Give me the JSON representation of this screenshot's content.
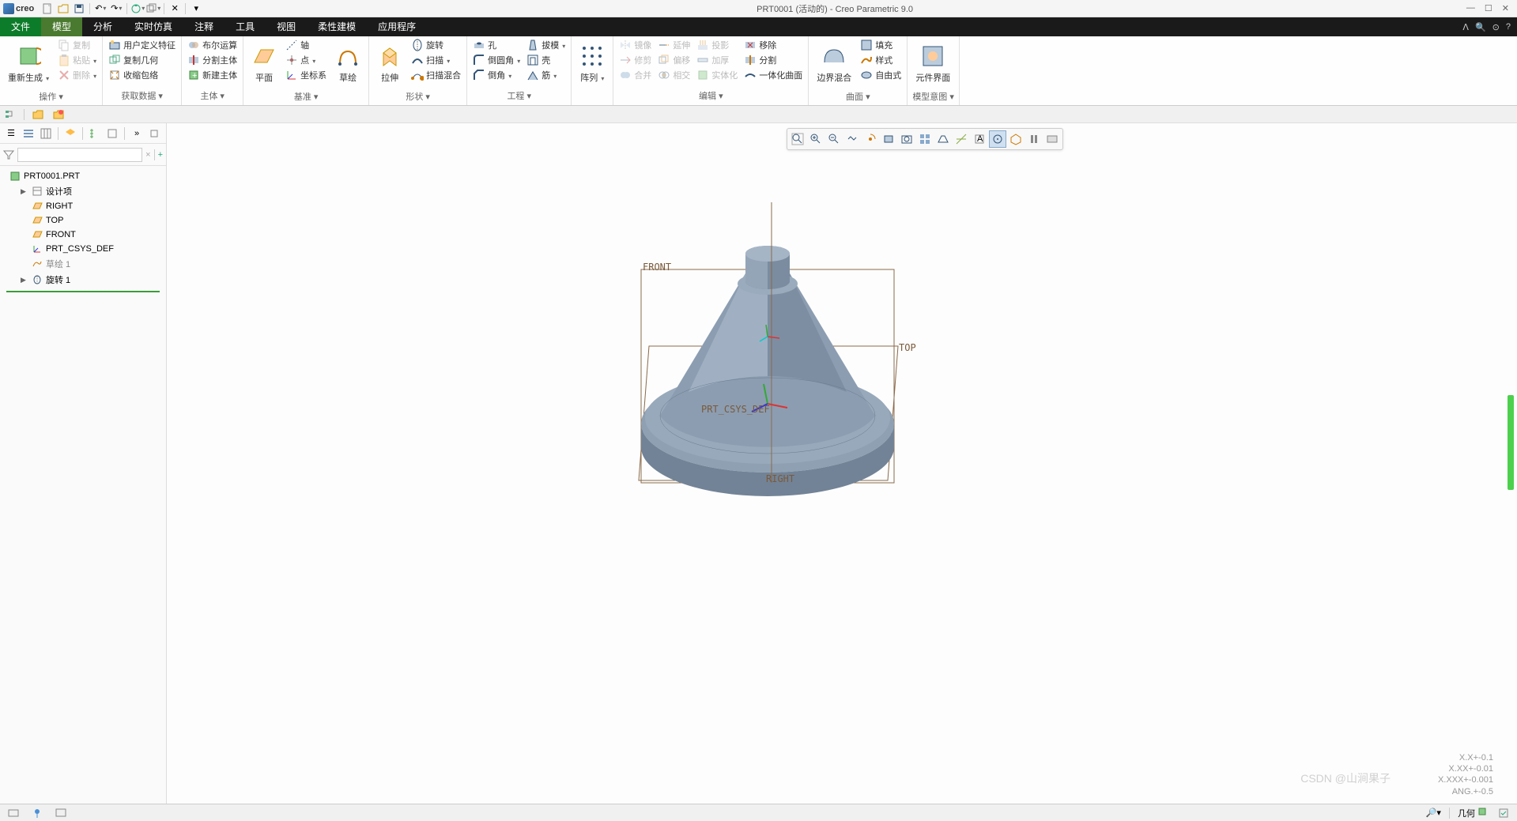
{
  "app": {
    "logo": "creo",
    "title": "PRT0001 (活动的) - Creo Parametric 9.0"
  },
  "menu": {
    "tabs": [
      "文件",
      "模型",
      "分析",
      "实时仿真",
      "注释",
      "工具",
      "视图",
      "柔性建模",
      "应用程序"
    ],
    "activeIndex": 1
  },
  "ribbon": {
    "groups": [
      {
        "label": "操作 ▾",
        "cols": [
          {
            "big": true,
            "items": [
              {
                "icon": "regen",
                "label": "重新生成",
                "arrow": true
              }
            ]
          },
          {
            "items": [
              {
                "icon": "copy",
                "label": "复制",
                "disabled": true
              },
              {
                "icon": "paste",
                "label": "粘贴",
                "arrow": true,
                "disabled": true
              },
              {
                "icon": "delete",
                "label": "删除",
                "arrow": true,
                "disabled": true
              }
            ]
          }
        ]
      },
      {
        "label": "获取数据 ▾",
        "cols": [
          {
            "items": [
              {
                "icon": "udf",
                "label": "用户定义特征"
              },
              {
                "icon": "copygeom",
                "label": "复制几何"
              },
              {
                "icon": "shrink",
                "label": "收缩包络"
              }
            ]
          }
        ]
      },
      {
        "label": "主体 ▾",
        "cols": [
          {
            "items": [
              {
                "icon": "bool",
                "label": "布尔运算"
              },
              {
                "icon": "split",
                "label": "分割主体"
              },
              {
                "icon": "newbody",
                "label": "新建主体"
              }
            ]
          }
        ]
      },
      {
        "label": "基准 ▾",
        "cols": [
          {
            "big": true,
            "items": [
              {
                "icon": "plane",
                "label": "平面"
              }
            ]
          },
          {
            "items": [
              {
                "icon": "axis",
                "label": "轴"
              },
              {
                "icon": "point",
                "label": "点",
                "arrow": true
              },
              {
                "icon": "csys",
                "label": "坐标系"
              }
            ]
          },
          {
            "big": true,
            "items": [
              {
                "icon": "sketch",
                "label": "草绘"
              }
            ]
          }
        ]
      },
      {
        "label": "形状 ▾",
        "cols": [
          {
            "big": true,
            "items": [
              {
                "icon": "extrude",
                "label": "拉伸"
              }
            ]
          },
          {
            "items": [
              {
                "icon": "revolve",
                "label": "旋转"
              },
              {
                "icon": "sweep",
                "label": "扫描",
                "arrow": true
              },
              {
                "icon": "sweepblend",
                "label": "扫描混合"
              }
            ]
          }
        ]
      },
      {
        "label": "工程 ▾",
        "cols": [
          {
            "items": [
              {
                "icon": "hole",
                "label": "孔"
              },
              {
                "icon": "round",
                "label": "倒圆角",
                "arrow": true
              },
              {
                "icon": "chamfer",
                "label": "倒角",
                "arrow": true
              }
            ]
          },
          {
            "items": [
              {
                "icon": "draft",
                "label": "拔模",
                "arrow": true
              },
              {
                "icon": "shell",
                "label": "壳"
              },
              {
                "icon": "rib",
                "label": "筋",
                "arrow": true
              }
            ]
          }
        ]
      },
      {
        "label": "",
        "cols": [
          {
            "big": true,
            "items": [
              {
                "icon": "pattern",
                "label": "阵列",
                "arrow": true
              }
            ]
          }
        ]
      },
      {
        "label": "编辑 ▾",
        "cols": [
          {
            "items": [
              {
                "icon": "mirror",
                "label": "镜像",
                "disabled": true
              },
              {
                "icon": "trim",
                "label": "修剪",
                "disabled": true
              },
              {
                "icon": "merge",
                "label": "合并",
                "disabled": true
              }
            ]
          },
          {
            "items": [
              {
                "icon": "extend",
                "label": "延伸",
                "disabled": true
              },
              {
                "icon": "offset",
                "label": "偏移",
                "disabled": true
              },
              {
                "icon": "intersect",
                "label": "相交",
                "disabled": true
              }
            ]
          },
          {
            "items": [
              {
                "icon": "project",
                "label": "投影",
                "disabled": true
              },
              {
                "icon": "thicken",
                "label": "加厚",
                "disabled": true
              },
              {
                "icon": "solidify",
                "label": "实体化",
                "disabled": true
              }
            ]
          },
          {
            "items": [
              {
                "icon": "remove",
                "label": "移除"
              },
              {
                "icon": "divide",
                "label": "分割"
              },
              {
                "icon": "onesurf",
                "label": "一体化曲面"
              }
            ]
          }
        ]
      },
      {
        "label": "曲面 ▾",
        "cols": [
          {
            "big": true,
            "items": [
              {
                "icon": "boundary",
                "label": "边界混合"
              }
            ]
          },
          {
            "items": [
              {
                "icon": "fill",
                "label": "填充"
              },
              {
                "icon": "style",
                "label": "样式"
              },
              {
                "icon": "freeform",
                "label": "自由式"
              }
            ]
          }
        ]
      },
      {
        "label": "模型意图 ▾",
        "cols": [
          {
            "big": true,
            "items": [
              {
                "icon": "compsurf",
                "label": "元件界面"
              }
            ]
          }
        ]
      }
    ]
  },
  "tree": {
    "root": "PRT0001.PRT",
    "items": [
      {
        "icon": "design",
        "label": "设计项",
        "expand": "▶"
      },
      {
        "icon": "datum-plane",
        "label": "RIGHT"
      },
      {
        "icon": "datum-plane",
        "label": "TOP"
      },
      {
        "icon": "datum-plane",
        "label": "FRONT"
      },
      {
        "icon": "csys",
        "label": "PRT_CSYS_DEF"
      },
      {
        "icon": "sketch",
        "label": "草绘 1",
        "highlight": true
      },
      {
        "icon": "revolve",
        "label": "旋转 1",
        "expand": "▶"
      }
    ]
  },
  "viewport": {
    "front_label": "FRONT",
    "top_label": "TOP",
    "right_label": "RIGHT",
    "csys_label": "PRT_CSYS_DEF"
  },
  "status": {
    "precision": [
      "X.X+-0.1",
      "X.XX+-0.01",
      "X.XXX+-0.001",
      "ANG.+-0.5"
    ],
    "geom_label": "几何"
  },
  "watermark": "CSDN @山涧果子"
}
